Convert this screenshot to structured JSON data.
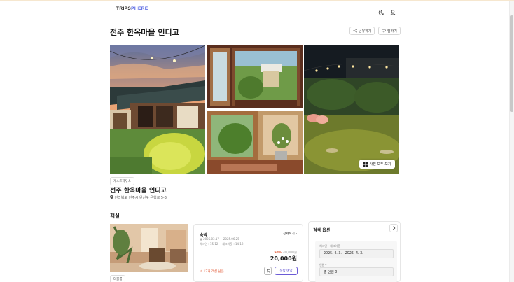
{
  "header": {
    "logo_part1": "TRIPS",
    "logo_part2": "PHERE",
    "icons": [
      "moon-icon",
      "user-icon"
    ]
  },
  "page": {
    "title": "전주 한옥마을 인디고",
    "share_label": "공유하기",
    "save_label": "찜하기",
    "show_all_photos_label": "사진 모두 보기"
  },
  "property": {
    "type_tag": "게스트하우스",
    "name": "전주 한옥마을 인디고",
    "address": "전라북도 전주시 완산구 은행로 5-3"
  },
  "rooms": {
    "section_title": "객실",
    "items": [
      {
        "tag": "더블룸",
        "name": "숙박",
        "detail_label": "상세보기",
        "period": "2025.03.17 ~ 2025.06.25",
        "checkin_out": "체크인 : 15:12 ~ 체크아웃 : 14:12",
        "discount": "50%",
        "original_price": "40,000원",
        "price": "20,000원",
        "remaining": "12개 객실 남음",
        "book_label": "숙박 예약"
      }
    ]
  },
  "search_options": {
    "title": "검색 옵션",
    "checkin_label": "체크인 - 체크아웃",
    "checkin_value": "2025. 4. 3. - 2025. 4. 3.",
    "guests_label": "인원수",
    "guests_value": "총 인원 0"
  },
  "colors": {
    "brand": "#4a5be0",
    "accent": "#5b4bd0",
    "alert": "#e0522d"
  }
}
